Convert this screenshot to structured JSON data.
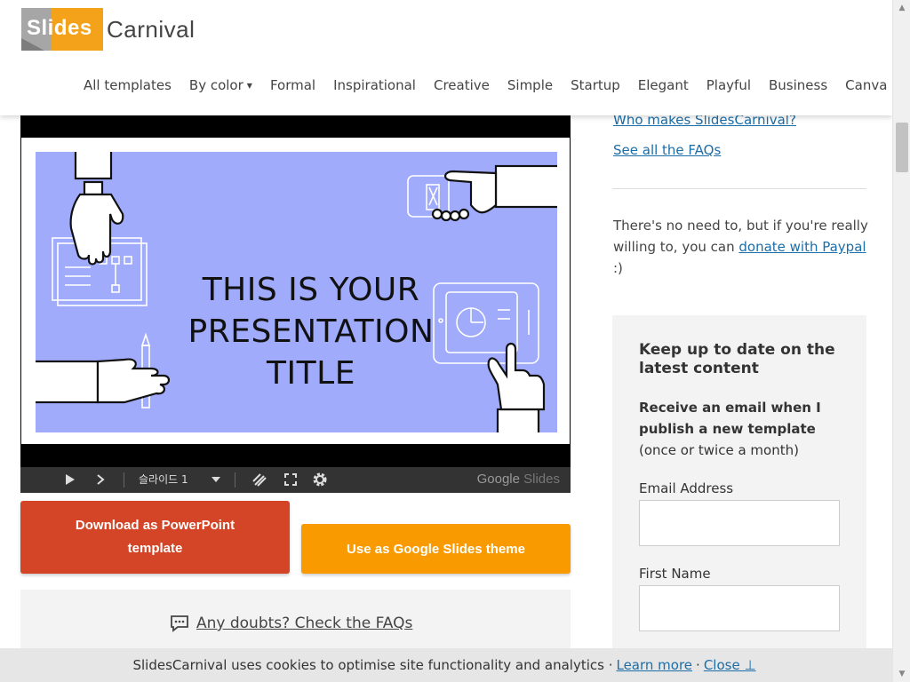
{
  "logo": {
    "box_text": "Slides",
    "text": "Carnival"
  },
  "nav": [
    {
      "label": "All templates"
    },
    {
      "label": "By color"
    },
    {
      "label": "Formal"
    },
    {
      "label": "Inspirational"
    },
    {
      "label": "Creative"
    },
    {
      "label": "Simple"
    },
    {
      "label": "Startup"
    },
    {
      "label": "Elegant"
    },
    {
      "label": "Playful"
    },
    {
      "label": "Business"
    },
    {
      "label": "Canva"
    }
  ],
  "slide": {
    "title_line1": "THIS IS YOUR",
    "title_line2": "PRESENTATION",
    "title_line3": "TITLE"
  },
  "player": {
    "slide_label": "슬라이드 1",
    "brand_google": "Google",
    "brand_slides": "Slides"
  },
  "buttons": {
    "download_ppt": "Download as PowerPoint template",
    "google_slides": "Use as Google Slides theme"
  },
  "faq": {
    "label": "Any doubts? Check the FAQs"
  },
  "right": {
    "who_makes": "Who makes SlidesCarnival?",
    "see_faqs": "See all the FAQs",
    "donate_pre": "There's no need to, but if you're really willing to, you can ",
    "donate_link": "donate with Paypal",
    "donate_post": " :)"
  },
  "subscribe": {
    "title": "Keep up to date on the latest content",
    "desc_bold": "Receive an email when I publish a new template",
    "desc_rest": "(once or twice a month)",
    "email_label": "Email Address",
    "first_name_label": "First Name"
  },
  "cookie": {
    "text": "SlidesCarnival uses cookies to optimise site functionality and analytics ·",
    "learn_more": "Learn more",
    "sep": "·",
    "close": "Close ⊥"
  },
  "colors": {
    "slide_bg": "#a1abfb",
    "ppt_button": "#d34526",
    "gs_button": "#f89a00",
    "link": "#1b6ea8",
    "logo_orange": "#f5a21b"
  }
}
